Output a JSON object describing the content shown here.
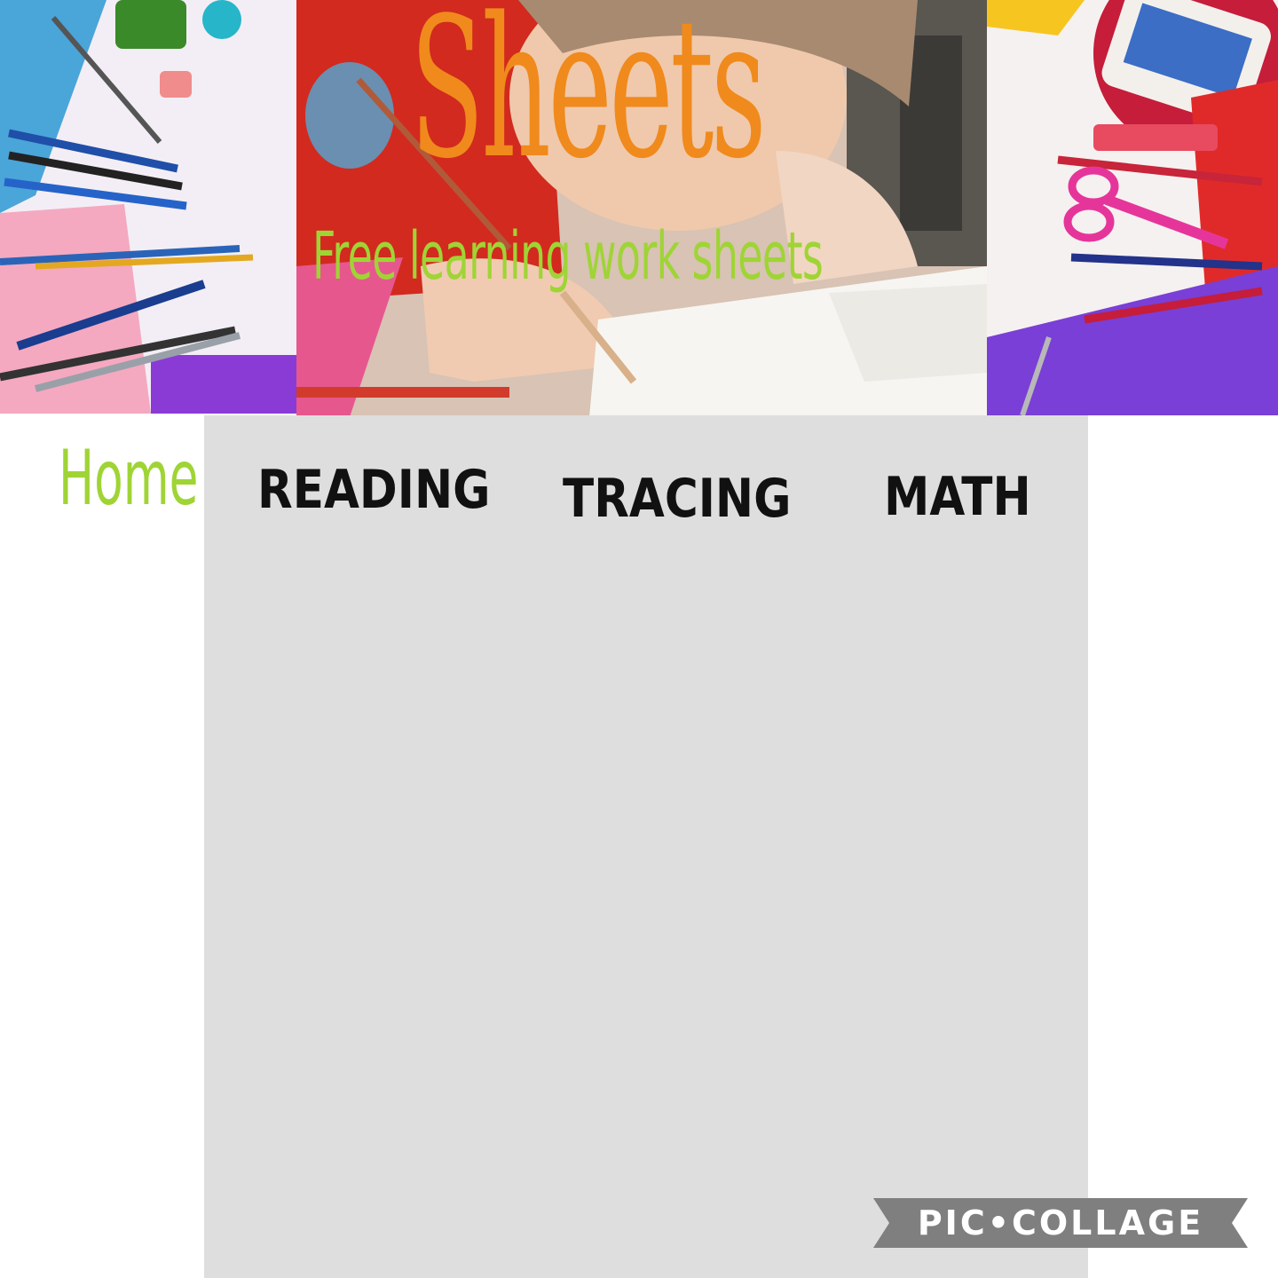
{
  "header": {
    "title": "Sheets",
    "tagline": "Free learning work sheets",
    "title_color": "#f08a1c",
    "tagline_color": "#9fd435",
    "images": {
      "left": "art-supplies-photo",
      "center": "child-writing-photo",
      "right": "watercolor-scissors-photo"
    }
  },
  "nav": {
    "home": "Home",
    "reading": "READING",
    "tracing": "TRACING",
    "math": "MATH",
    "active_color": "#9fd435"
  },
  "content": {
    "background": "#dedede"
  },
  "watermark": {
    "text": "PIC•COLLAGE"
  }
}
